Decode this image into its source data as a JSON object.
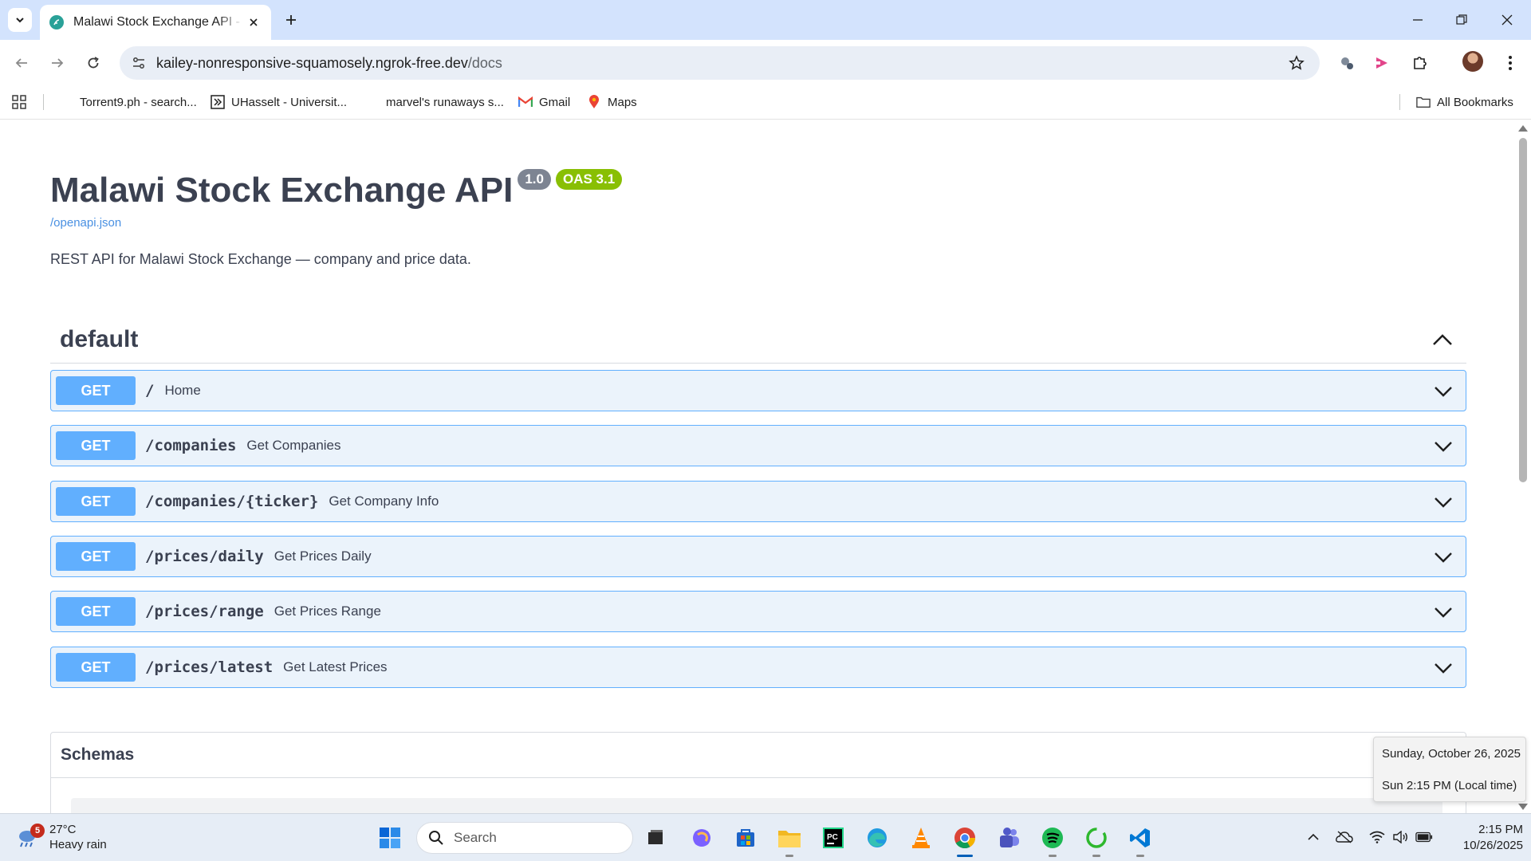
{
  "browser": {
    "tab_title": "Malawi Stock Exchange API - Swagger UI",
    "url_host": "kailey-nonresponsive-squamosely.ngrok-free.dev",
    "url_path": "/docs",
    "bookmarks": [
      {
        "label": "Torrent9.ph - search...",
        "icon": "torrent-favicon"
      },
      {
        "label": "UHasselt - Universit...",
        "icon": "uhasselt-favicon"
      },
      {
        "label": "marvel's runaways s...",
        "icon": "blank-favicon"
      },
      {
        "label": "Gmail",
        "icon": "gmail-icon"
      },
      {
        "label": "Maps",
        "icon": "maps-icon"
      }
    ],
    "all_bookmarks_label": "All Bookmarks"
  },
  "api": {
    "title": "Malawi Stock Exchange API",
    "version": "1.0",
    "oas": "OAS 3.1",
    "spec_link": "/openapi.json",
    "description": "REST API for Malawi Stock Exchange — company and price data."
  },
  "tag": {
    "name": "default"
  },
  "operations": [
    {
      "method": "GET",
      "path": "/",
      "summary": "Home"
    },
    {
      "method": "GET",
      "path": "/companies",
      "summary": "Get Companies"
    },
    {
      "method": "GET",
      "path": "/companies/{ticker}",
      "summary": "Get Company Info"
    },
    {
      "method": "GET",
      "path": "/prices/daily",
      "summary": "Get Prices Daily"
    },
    {
      "method": "GET",
      "path": "/prices/range",
      "summary": "Get Prices Range"
    },
    {
      "method": "GET",
      "path": "/prices/latest",
      "summary": "Get Latest Prices"
    }
  ],
  "schemas": {
    "title": "Schemas"
  },
  "tooltip": {
    "date": "Sunday, October 26, 2025",
    "local_time": "Sun 2:15 PM (Local time)"
  },
  "taskbar": {
    "weather_alerts": "5",
    "temperature": "27°C",
    "condition": "Heavy rain",
    "search_placeholder": "Search",
    "time": "2:15 PM",
    "date": "10/26/2025"
  },
  "colors": {
    "get_method": "#61affe",
    "get_bg": "#ebf3fb",
    "version_badge": "#7d8492",
    "oas_badge": "#89bf04",
    "link": "#4990e2",
    "chrome_tabbar": "#d3e3fd"
  }
}
